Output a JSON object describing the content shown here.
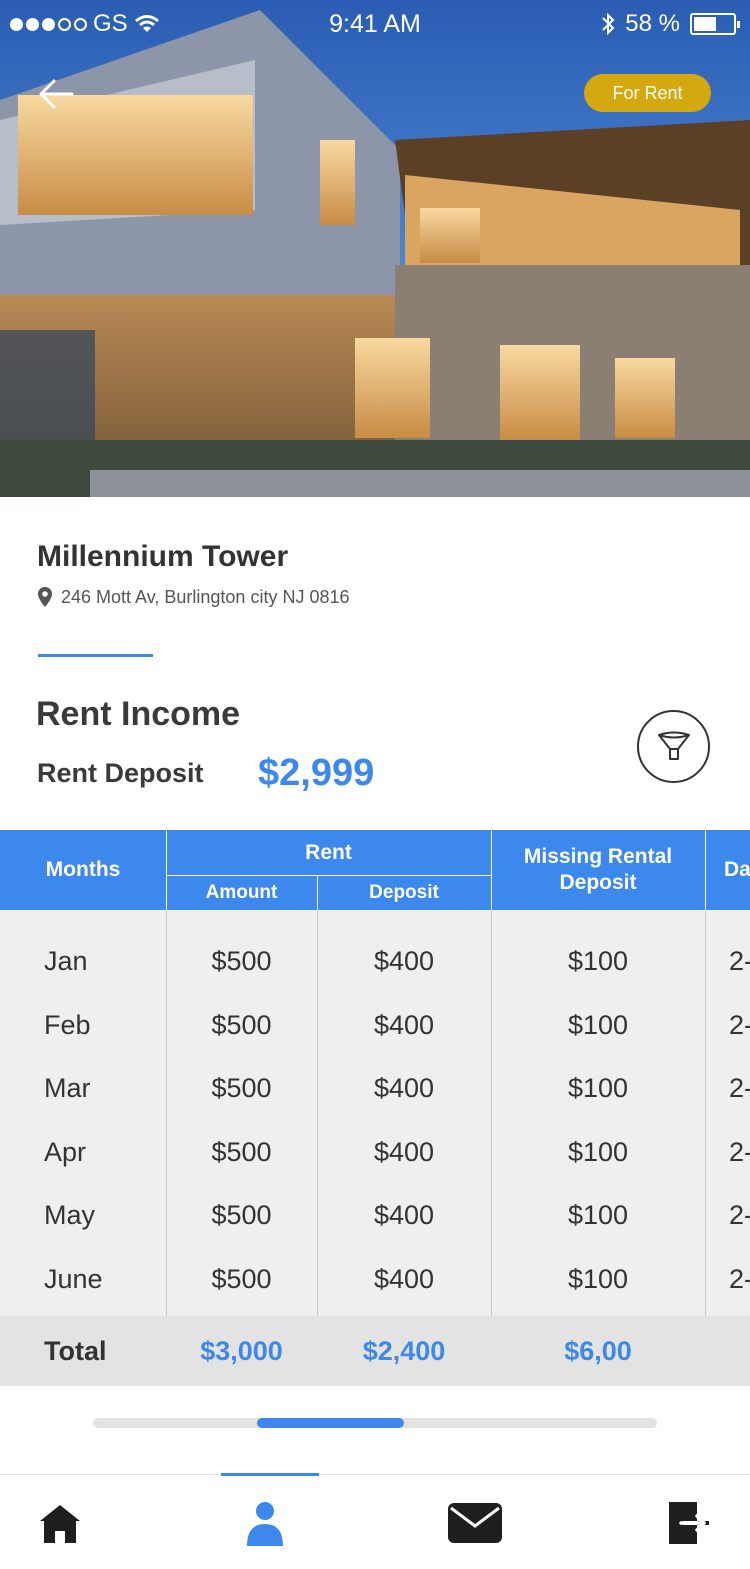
{
  "status_bar": {
    "carrier": "GS",
    "time": "9:41 AM",
    "battery_text": "58 %",
    "battery_level": 0.58
  },
  "hero": {
    "badge": "For Rent"
  },
  "property": {
    "name": "Millennium Tower",
    "address": "246 Mott Av, Burlington city NJ 0816"
  },
  "summary": {
    "title": "Rent Income",
    "deposit_label": "Rent Deposit",
    "deposit_value": "$2,999"
  },
  "table": {
    "headers": {
      "months": "Months",
      "rent": "Rent",
      "amount": "Amount",
      "deposit": "Deposit",
      "missing": "Missing Rental Deposit",
      "date_partial": "Da"
    },
    "rows": [
      {
        "month": "Jan",
        "amount": "$500",
        "deposit": "$400",
        "missing": "$100",
        "date_partial": "2-"
      },
      {
        "month": "Feb",
        "amount": "$500",
        "deposit": "$400",
        "missing": "$100",
        "date_partial": "2-"
      },
      {
        "month": "Mar",
        "amount": "$500",
        "deposit": "$400",
        "missing": "$100",
        "date_partial": "2-"
      },
      {
        "month": "Apr",
        "amount": "$500",
        "deposit": "$400",
        "missing": "$100",
        "date_partial": "2-"
      },
      {
        "month": "May",
        "amount": "$500",
        "deposit": "$400",
        "missing": "$100",
        "date_partial": "2-"
      },
      {
        "month": "June",
        "amount": "$500",
        "deposit": "$400",
        "missing": "$100",
        "date_partial": "2-"
      }
    ],
    "totals": {
      "label": "Total",
      "amount": "$3,000",
      "deposit": "$2,400",
      "missing": "$6,00"
    }
  },
  "horizontal_scroll": {
    "position_fraction": 0.29,
    "visible_fraction": 0.26
  },
  "tabbar": {
    "items": [
      "home-icon",
      "profile-icon",
      "mail-icon",
      "logout-icon"
    ],
    "active_index": 1
  },
  "colors": {
    "accent": "#3d88ec",
    "badge": "#d4a90f",
    "text_dark": "#333333"
  }
}
